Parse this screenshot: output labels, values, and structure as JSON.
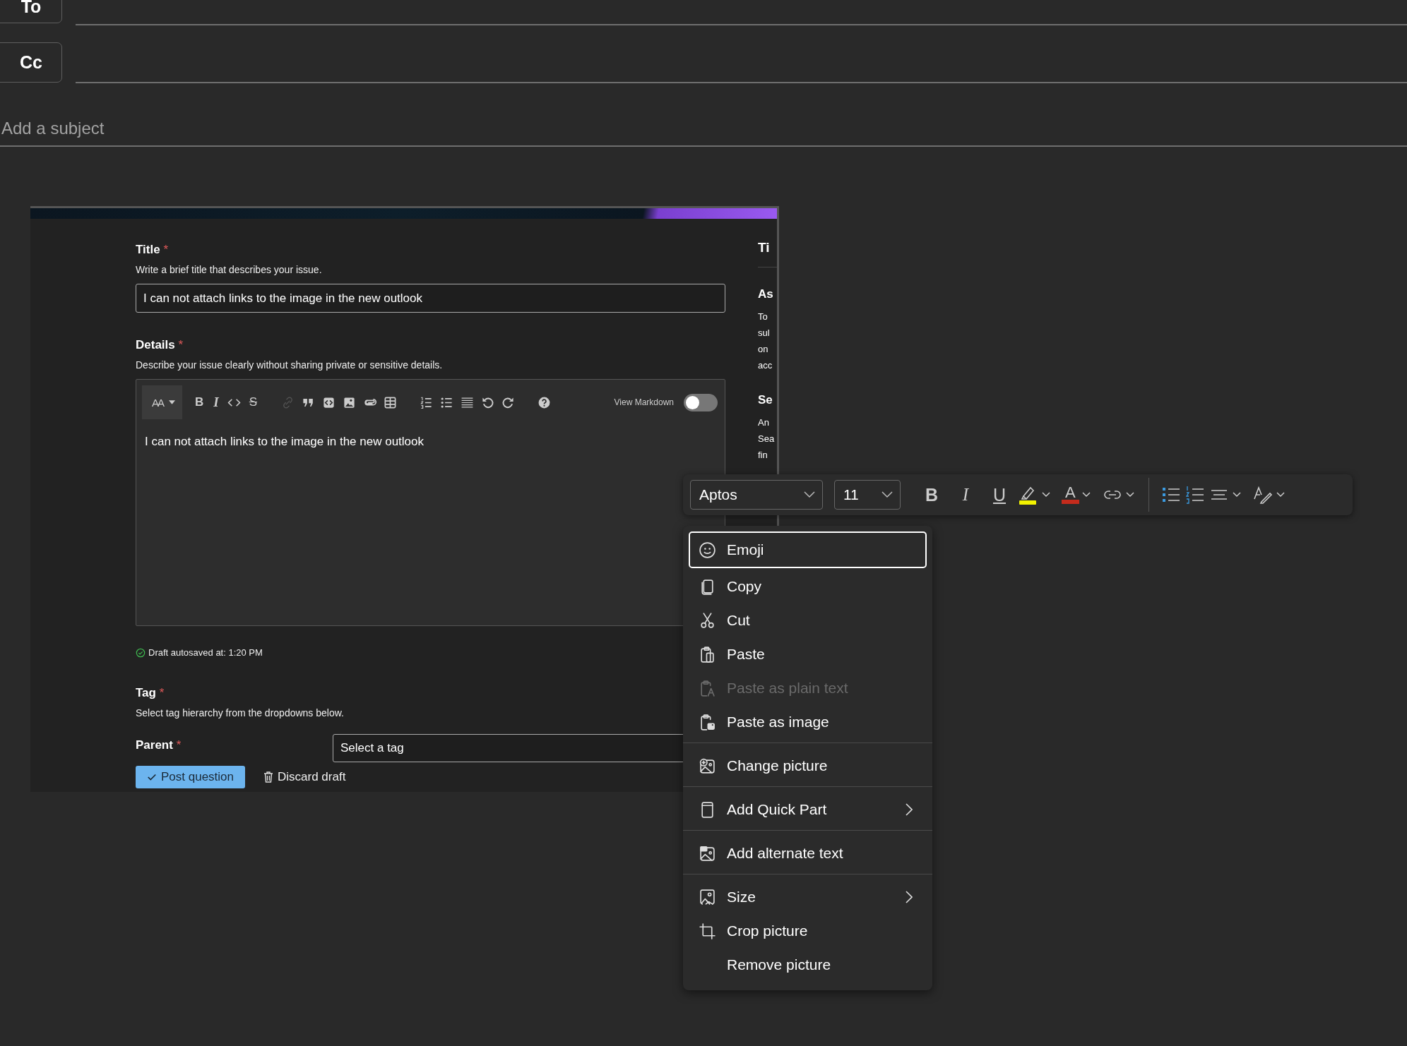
{
  "compose": {
    "recipients": [
      {
        "label": "To"
      },
      {
        "label": "Cc"
      }
    ],
    "subject": {
      "placeholder": "Add a subject"
    }
  },
  "form": {
    "title": {
      "label": "Title",
      "required_mark": "*",
      "hint": "Write a brief title that describes your issue.",
      "value": "I can not attach links to the image in the new outlook"
    },
    "details": {
      "label": "Details",
      "required_mark": "*",
      "hint": "Describe your issue clearly without sharing private or sensitive details.",
      "toolbar": {
        "text_size": "AA",
        "bold": "B",
        "italic": "I",
        "strike": "S",
        "view_markdown": {
          "label": "View Markdown",
          "on": false
        }
      },
      "value": "I can not attach links to the image in the new outlook"
    },
    "autosave": "Draft autosaved at: 1:20 PM",
    "tag": {
      "label": "Tag",
      "required_mark": "*",
      "hint": "Select tag hierarchy from the dropdowns below."
    },
    "parent": {
      "label": "Parent",
      "required_mark": "*",
      "placeholder": "Select a tag"
    },
    "buttons": {
      "post": "Post question",
      "discard": "Discard draft"
    },
    "sidebar_fragments": [
      {
        "text": "Ti",
        "kind": "heading"
      },
      {
        "text": "As",
        "kind": "heading"
      },
      {
        "text": "To",
        "kind": "text"
      },
      {
        "text": "sul",
        "kind": "text"
      },
      {
        "text": "on",
        "kind": "text"
      },
      {
        "text": "acc",
        "kind": "text"
      },
      {
        "text": "Se",
        "kind": "heading"
      },
      {
        "text": "An",
        "kind": "text"
      },
      {
        "text": "Sea",
        "kind": "text"
      },
      {
        "text": "fin",
        "kind": "text"
      }
    ]
  },
  "format_toolbar": {
    "font": "Aptos",
    "size": "11",
    "bold": "B",
    "italic": "I",
    "underline": "U",
    "font_color": "A"
  },
  "context_menu": {
    "groups": [
      [
        {
          "label": "Emoji",
          "selected": true,
          "disabled": false,
          "submenu": false
        },
        {
          "label": "Copy",
          "selected": false,
          "disabled": false,
          "submenu": false
        },
        {
          "label": "Cut",
          "selected": false,
          "disabled": false,
          "submenu": false
        },
        {
          "label": "Paste",
          "selected": false,
          "disabled": false,
          "submenu": false
        },
        {
          "label": "Paste as plain text",
          "selected": false,
          "disabled": true,
          "submenu": false
        },
        {
          "label": "Paste as image",
          "selected": false,
          "disabled": false,
          "submenu": false
        }
      ],
      [
        {
          "label": "Change picture",
          "selected": false,
          "disabled": false,
          "submenu": false
        }
      ],
      [
        {
          "label": "Add Quick Part",
          "selected": false,
          "disabled": false,
          "submenu": true
        }
      ],
      [
        {
          "label": "Add alternate text",
          "selected": false,
          "disabled": false,
          "submenu": false
        }
      ],
      [
        {
          "label": "Size",
          "selected": false,
          "disabled": false,
          "submenu": true
        },
        {
          "label": "Crop picture",
          "selected": false,
          "disabled": false,
          "submenu": false
        },
        {
          "label": "Remove picture",
          "selected": false,
          "disabled": false,
          "submenu": false
        }
      ]
    ]
  }
}
